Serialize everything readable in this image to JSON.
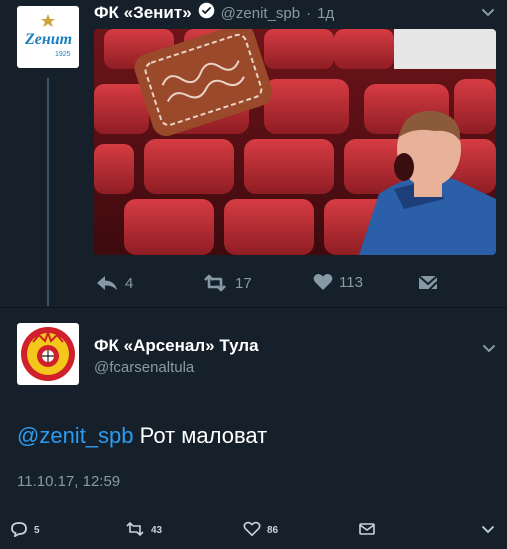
{
  "tweet1": {
    "name": "ФК «Зенит»",
    "handle": "@zenit_spb",
    "separator": "·",
    "time": "1д",
    "logo_text": "Zенит",
    "logo_year": "1925",
    "actions": {
      "reply": "4",
      "retweet": "17",
      "like": "113"
    }
  },
  "tweet2": {
    "name": "ФК «Арсенал» Тула",
    "handle": "@fcarsenaltula",
    "mention": "@zenit_spb",
    "text": " Рот маловат",
    "timestamp": "11.10.17, 12:59",
    "actions": {
      "reply": "5",
      "retweet": "43",
      "like": "86"
    }
  },
  "colors": {
    "background": "#15202b",
    "accent": "#2b9cf2",
    "muted": "#8899a6"
  },
  "icons": [
    "verified-badge-icon",
    "chevron-down-icon",
    "reply-icon",
    "retweet-icon",
    "like-icon",
    "dm-icon",
    "envelope-icon"
  ]
}
